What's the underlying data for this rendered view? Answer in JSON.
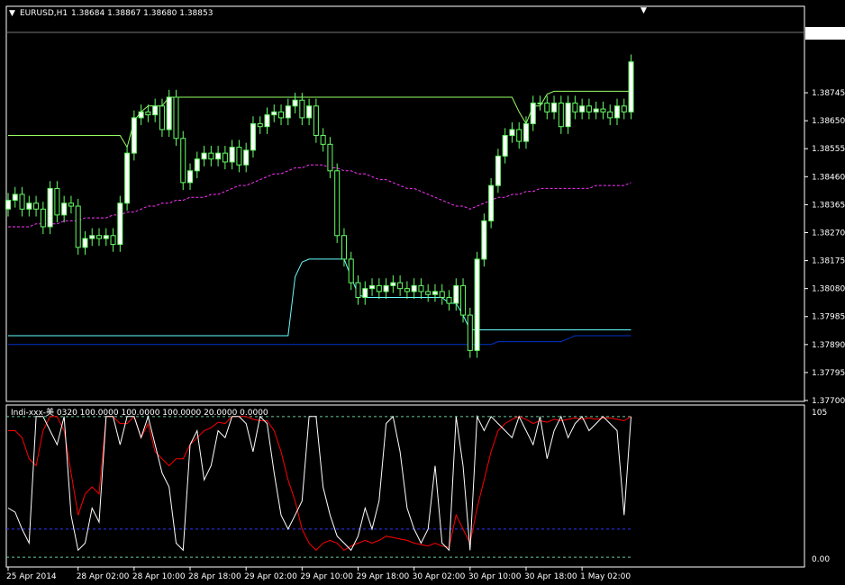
{
  "header": {
    "symbol": "EURUSD,H1",
    "ohlc": "1.38684 1.38867 1.38680 1.38853"
  },
  "indicator_header": "Indi-xxx-美 0320 100.0000 100.0000 100.0000 20.0000 0.0000",
  "current_price": "1.38853",
  "colors": {
    "background": "#000000",
    "frame": "#ffffff",
    "bull_candle": "#ffffff",
    "bear_candle": "#000000",
    "wick": "#66ff66",
    "upper_channel": "#99ff66",
    "lower_channel": "#66ffff",
    "ma_dashed": "#ff33ff",
    "blue_line": "#0033cc",
    "yellow_line": "#ffff00",
    "osc_white": "#ffffff",
    "osc_red": "#ff0000",
    "osc_level": "#3333ff"
  },
  "chart_data": [
    {
      "type": "candlestick",
      "ylim": [
        1.377,
        1.3895
      ],
      "y_ticks": [
        "1.38745",
        "1.38650",
        "1.38555",
        "1.38460",
        "1.38365",
        "1.38270",
        "1.38175",
        "1.38080",
        "1.37985",
        "1.37890",
        "1.37795",
        "1.37700"
      ],
      "x_ticks": [
        {
          "label": "25 Apr 2014",
          "index": 0
        },
        {
          "label": "28 Apr 02:00",
          "index": 10
        },
        {
          "label": "28 Apr 10:00",
          "index": 18
        },
        {
          "label": "28 Apr 18:00",
          "index": 26
        },
        {
          "label": "29 Apr 02:00",
          "index": 34
        },
        {
          "label": "29 Apr 10:00",
          "index": 42
        },
        {
          "label": "29 Apr 18:00",
          "index": 50
        },
        {
          "label": "30 Apr 02:00",
          "index": 58
        },
        {
          "label": "30 Apr 10:00",
          "index": 66
        },
        {
          "label": "30 Apr 18:00",
          "index": 74
        },
        {
          "label": "1 May 02:00",
          "index": 82
        }
      ],
      "close": [
        1.3838,
        1.384,
        1.3835,
        1.3837,
        1.3835,
        1.3829,
        1.3842,
        1.3833,
        1.3837,
        1.3836,
        1.3822,
        1.3825,
        1.3826,
        1.3825,
        1.3826,
        1.3823,
        1.3837,
        1.3854,
        1.3866,
        1.3868,
        1.3867,
        1.387,
        1.3862,
        1.3873,
        1.3859,
        1.3844,
        1.3848,
        1.3852,
        1.3854,
        1.3852,
        1.3854,
        1.3851,
        1.3856,
        1.385,
        1.3855,
        1.3864,
        1.3863,
        1.3867,
        1.3868,
        1.3866,
        1.387,
        1.3872,
        1.3866,
        1.387,
        1.386,
        1.3857,
        1.3848,
        1.3826,
        1.3818,
        1.381,
        1.3805,
        1.3808,
        1.3809,
        1.3807,
        1.3809,
        1.381,
        1.3808,
        1.3807,
        1.3809,
        1.3807,
        1.3806,
        1.3807,
        1.3805,
        1.3803,
        1.3809,
        1.3799,
        1.3787,
        1.3818,
        1.3831,
        1.3843,
        1.3853,
        1.386,
        1.3862,
        1.3858,
        1.3864,
        1.3871,
        1.3871,
        1.3868,
        1.3871,
        1.3863,
        1.3871,
        1.3868,
        1.387,
        1.3868,
        1.3869,
        1.3868,
        1.3866,
        1.387,
        1.3868,
        1.3885
      ],
      "series": [
        {
          "name": "Indi-xxx-美 white",
          "type": "line",
          "panel": "oscillator",
          "ylim": [
            -5,
            105
          ],
          "values": [
            35,
            32,
            20,
            10,
            100,
            100,
            90,
            80,
            100,
            30,
            5,
            10,
            35,
            25,
            100,
            100,
            80,
            100,
            100,
            85,
            100,
            80,
            60,
            50,
            10,
            5,
            80,
            90,
            55,
            65,
            90,
            85,
            100,
            100,
            95,
            75,
            100,
            95,
            60,
            30,
            20,
            30,
            40,
            100,
            100,
            50,
            30,
            15,
            10,
            5,
            15,
            35,
            20,
            40,
            95,
            100,
            75,
            35,
            20,
            10,
            20,
            65,
            10,
            5,
            100,
            65,
            5,
            100,
            90,
            100,
            95,
            90,
            85,
            100,
            90,
            80,
            100,
            70,
            90,
            100,
            85,
            95,
            100,
            90,
            95,
            100,
            95,
            90,
            30,
            100
          ]
        },
        {
          "name": "Indi-xxx-美 red",
          "type": "line",
          "panel": "oscillator",
          "ylim": [
            -5,
            105
          ],
          "values": [
            90,
            90,
            85,
            70,
            65,
            90,
            100,
            100,
            90,
            60,
            30,
            45,
            50,
            45,
            100,
            100,
            95,
            95,
            100,
            85,
            95,
            75,
            70,
            65,
            70,
            70,
            80,
            85,
            90,
            92,
            96,
            95,
            100,
            100,
            100,
            98,
            97,
            97,
            90,
            75,
            55,
            40,
            20,
            10,
            5,
            10,
            12,
            10,
            5,
            8,
            10,
            12,
            10,
            12,
            15,
            14,
            13,
            12,
            10,
            9,
            8,
            10,
            8,
            7,
            30,
            20,
            10,
            35,
            55,
            75,
            90,
            95,
            98,
            100,
            98,
            95,
            97,
            96,
            98,
            97,
            98,
            99,
            98,
            99,
            98,
            99,
            99,
            98,
            97,
            100
          ]
        },
        {
          "name": "upper channel",
          "type": "line",
          "values": [
            1.386,
            1.386,
            1.386,
            1.386,
            1.386,
            1.386,
            1.386,
            1.386,
            1.386,
            1.386,
            1.386,
            1.386,
            1.386,
            1.386,
            1.386,
            1.386,
            1.386,
            1.3856,
            1.3865,
            1.3868,
            1.387,
            1.387,
            1.387,
            1.3873,
            1.3873,
            1.3873,
            1.3873,
            1.3873,
            1.3873,
            1.3873,
            1.3873,
            1.3873,
            1.3873,
            1.3873,
            1.3873,
            1.3873,
            1.3873,
            1.3873,
            1.3873,
            1.3873,
            1.3873,
            1.3873,
            1.3873,
            1.3873,
            1.3873,
            1.3873,
            1.3873,
            1.3873,
            1.3873,
            1.3873,
            1.3873,
            1.3873,
            1.3873,
            1.3873,
            1.3873,
            1.3873,
            1.3873,
            1.3873,
            1.3873,
            1.3873,
            1.3873,
            1.3873,
            1.3873,
            1.3873,
            1.3873,
            1.3873,
            1.3873,
            1.3873,
            1.3873,
            1.3873,
            1.3873,
            1.3873,
            1.3873,
            1.3868,
            1.3864,
            1.387,
            1.387,
            1.3874,
            1.3875,
            1.3875,
            1.3875,
            1.3875,
            1.3875,
            1.3875,
            1.3875,
            1.3875,
            1.3875,
            1.3875,
            1.3875,
            1.3875
          ]
        },
        {
          "name": "lower channel",
          "type": "line",
          "values": [
            1.3792,
            1.3792,
            1.3792,
            1.3792,
            1.3792,
            1.3792,
            1.3792,
            1.3792,
            1.3792,
            1.3792,
            1.3792,
            1.3792,
            1.3792,
            1.3792,
            1.3792,
            1.3792,
            1.3792,
            1.3792,
            1.3792,
            1.3792,
            1.3792,
            1.3792,
            1.3792,
            1.3792,
            1.3792,
            1.3792,
            1.3792,
            1.3792,
            1.3792,
            1.3792,
            1.3792,
            1.3792,
            1.3792,
            1.3792,
            1.3792,
            1.3792,
            1.3792,
            1.3792,
            1.3792,
            1.3792,
            1.3792,
            1.3812,
            1.3817,
            1.3818,
            1.3818,
            1.3818,
            1.3818,
            1.3818,
            1.3818,
            1.3812,
            1.3806,
            1.3805,
            1.3805,
            1.3805,
            1.3805,
            1.3805,
            1.3805,
            1.3805,
            1.3805,
            1.3805,
            1.3805,
            1.3805,
            1.3805,
            1.3803,
            1.3803,
            1.3799,
            1.3794,
            1.3794,
            1.3794,
            1.3794,
            1.3794,
            1.3794,
            1.3794,
            1.3794,
            1.3794,
            1.3794,
            1.3794,
            1.3794,
            1.3794,
            1.3794,
            1.3794,
            1.3794,
            1.3794,
            1.3794,
            1.3794,
            1.3794,
            1.3794,
            1.3794,
            1.3794,
            1.3794
          ]
        },
        {
          "name": "dashed MA",
          "type": "line",
          "values": [
            1.3829,
            1.3829,
            1.3829,
            1.3829,
            1.383,
            1.383,
            1.383,
            1.383,
            1.3831,
            1.3831,
            1.3831,
            1.3832,
            1.3832,
            1.3832,
            1.3832,
            1.3833,
            1.3833,
            1.3834,
            1.3834,
            1.3835,
            1.3836,
            1.3836,
            1.3837,
            1.3837,
            1.3838,
            1.3838,
            1.3839,
            1.3839,
            1.3839,
            1.384,
            1.384,
            1.3841,
            1.3842,
            1.3843,
            1.3843,
            1.3844,
            1.3845,
            1.3846,
            1.3847,
            1.3847,
            1.3848,
            1.3849,
            1.3849,
            1.385,
            1.385,
            1.385,
            1.3849,
            1.3849,
            1.3848,
            1.3848,
            1.3847,
            1.3847,
            1.3846,
            1.3845,
            1.3845,
            1.3844,
            1.3843,
            1.3842,
            1.3842,
            1.3841,
            1.384,
            1.3839,
            1.3838,
            1.3837,
            1.3836,
            1.3836,
            1.3835,
            1.3836,
            1.3837,
            1.3838,
            1.3839,
            1.3839,
            1.384,
            1.384,
            1.3841,
            1.3841,
            1.3842,
            1.3842,
            1.3842,
            1.3842,
            1.3842,
            1.3842,
            1.3842,
            1.3842,
            1.3843,
            1.3843,
            1.3843,
            1.3843,
            1.3843,
            1.3844
          ]
        },
        {
          "name": "blue line",
          "type": "line",
          "values": [
            1.3789,
            1.3789,
            1.3789,
            1.3789,
            1.3789,
            1.3789,
            1.3789,
            1.3789,
            1.3789,
            1.3789,
            1.3789,
            1.3789,
            1.3789,
            1.3789,
            1.3789,
            1.3789,
            1.3789,
            1.3789,
            1.3789,
            1.3789,
            1.3789,
            1.3789,
            1.3789,
            1.3789,
            1.3789,
            1.3789,
            1.3789,
            1.3789,
            1.3789,
            1.3789,
            1.3789,
            1.3789,
            1.3789,
            1.3789,
            1.3789,
            1.3789,
            1.3789,
            1.3789,
            1.3789,
            1.3789,
            1.3789,
            1.3789,
            1.3789,
            1.3789,
            1.3789,
            1.3789,
            1.3789,
            1.3789,
            1.3789,
            1.3789,
            1.3789,
            1.3789,
            1.3789,
            1.3789,
            1.3789,
            1.3789,
            1.3789,
            1.3789,
            1.3789,
            1.3789,
            1.3789,
            1.3789,
            1.3789,
            1.3789,
            1.3789,
            1.3789,
            1.3789,
            1.3789,
            1.3789,
            1.3789,
            1.379,
            1.379,
            1.379,
            1.379,
            1.379,
            1.379,
            1.379,
            1.379,
            1.379,
            1.379,
            1.3791,
            1.3792,
            1.3792,
            1.3792,
            1.3792,
            1.3792,
            1.3792,
            1.3792,
            1.3792,
            1.3792
          ]
        }
      ]
    }
  ]
}
